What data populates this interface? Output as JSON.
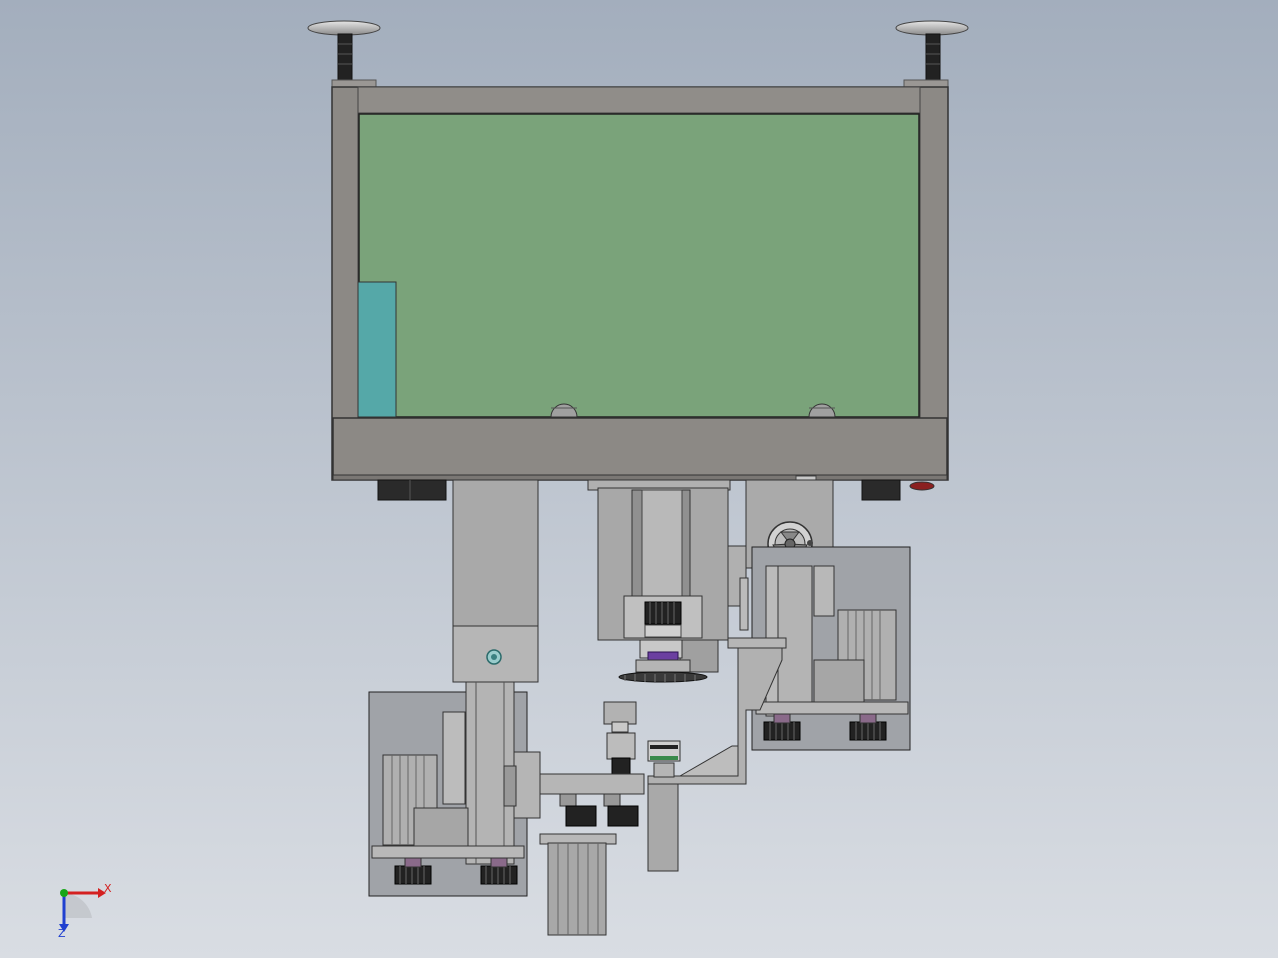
{
  "viewport": {
    "background_top": "#a3aebd",
    "background_bottom": "#d9dde3"
  },
  "colors": {
    "frame": "#8c8985",
    "frame_dark": "#6f6c69",
    "panel": "#7aa37a",
    "teal_block": "#55a8a8",
    "metal": "#a9a9a9",
    "metal_light": "#c4c4c4",
    "dark_part": "#2a2a2a",
    "purple_part": "#6b3fa0",
    "axis_x": "#d42020",
    "axis_y": "#17a617",
    "axis_z": "#2040d0"
  },
  "triad": {
    "x_label": "X",
    "z_label": "Z"
  }
}
